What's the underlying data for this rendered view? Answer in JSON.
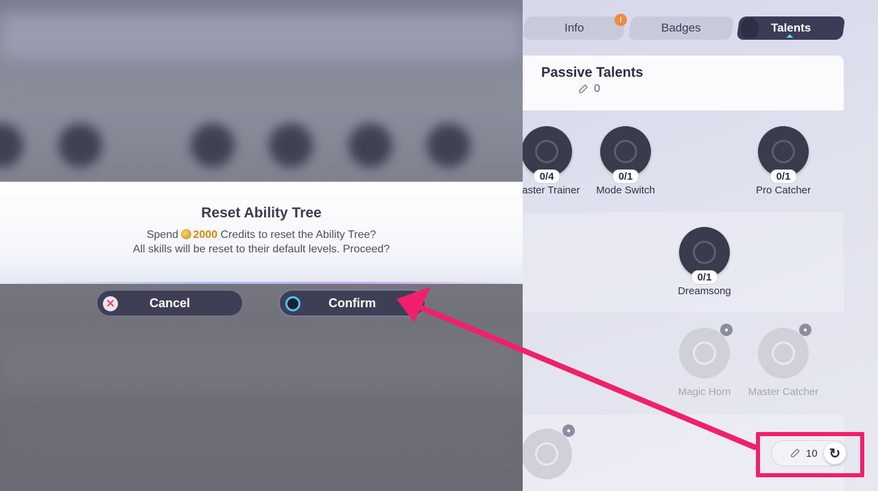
{
  "tabs": {
    "info": "Info",
    "badges": "Badges",
    "talents": "Talents",
    "info_notify": "!"
  },
  "passive": {
    "title": "Passive Talents",
    "points": "0"
  },
  "nodes": {
    "master_trainer": {
      "count": "0/4",
      "label": "Master Trainer"
    },
    "mode_switch": {
      "count": "0/1",
      "label": "Mode Switch"
    },
    "pro_catcher": {
      "count": "0/1",
      "label": "Pro Catcher"
    },
    "dreamsong": {
      "count": "0/1",
      "label": "Dreamsong"
    },
    "magic_horn": {
      "label": "Magic Horn"
    },
    "master_catcher": {
      "label": "Master Catcher"
    }
  },
  "reset": {
    "points": "10"
  },
  "dialog": {
    "title": "Reset Ability Tree",
    "line1_prefix": "Spend ",
    "credits": "2000",
    "line1_suffix": " Credits to reset the Ability Tree?",
    "line2": "All skills will be reset to their default levels. Proceed?",
    "cancel": "Cancel",
    "confirm": "Confirm"
  },
  "colors": {
    "annotation": "#f0206a",
    "credits": "#d08a12",
    "button_bg": "#3e3f55"
  }
}
